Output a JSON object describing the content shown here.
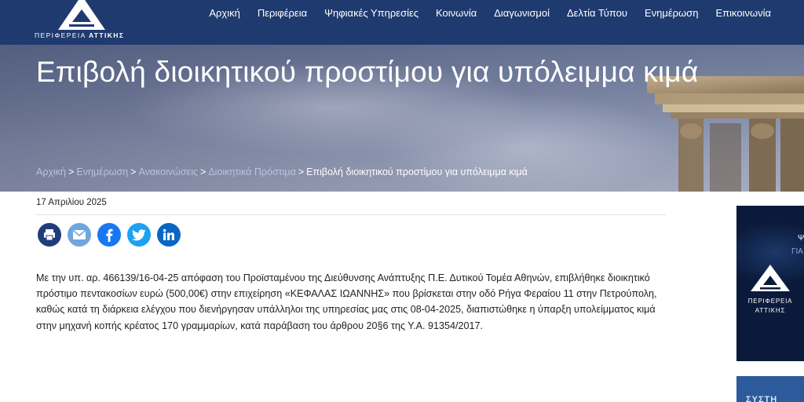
{
  "header": {
    "logo_text_prefix": "ΠΕΡΙΦΕΡΕΙΑ",
    "logo_text_bold": "ΑΤΤΙΚΗΣ",
    "nav": [
      {
        "label": "Αρχική"
      },
      {
        "label": "Περιφέρεια"
      },
      {
        "label": "Ψηφιακές Υπηρεσίες"
      },
      {
        "label": "Κοινωνία"
      },
      {
        "label": "Διαγωνισμοί"
      },
      {
        "label": "Δελτία Τύπου"
      },
      {
        "label": "Ενημέρωση"
      },
      {
        "label": "Επικοινωνία"
      }
    ]
  },
  "hero": {
    "title": "Επιβολή διοικητικού προστίμου για υπόλειμμα κιμά",
    "breadcrumb": {
      "items": [
        "Αρχική",
        "Ενημέρωση",
        "Ανακοινώσεις",
        "Διοικητικά Πρόστιμα"
      ],
      "current": "Επιβολή διοικητικού προστίμου για υπόλειμμα κιμά",
      "separator": ">"
    }
  },
  "article": {
    "date": "17 Απριλίου 2025",
    "share_icons": [
      "print-icon",
      "email-icon",
      "facebook-icon",
      "twitter-icon",
      "linkedin-icon"
    ],
    "body": "Με την υπ. αρ. 466139/16-04-25 απόφαση του Προϊσταμένου της Διεύθυνσης Ανάπτυξης Π.Ε. Δυτικού Τομέα Αθηνών, επιβλήθηκε διοικητικό πρόστιμο πεντακοσίων ευρώ (500,00€) στην επιχείρηση «ΚΕΦΑΛΑΣ ΙΩΑΝΝΗΣ» που βρίσκεται στην οδό Ρήγα Φεραίου 11 στην Πετρούπολη, καθώς κατά τη διάρκεια ελέγχου  που διενήργησαν υπάλληλοι της υπηρεσίας μας στις 08-04-2025, διαπιστώθηκε η ύπαρξη υπολείμματος κιμά στην μηχανή κοπής κρέατος 170 γραμμαρίων, κατά παράβαση του άρθρου 20§6 της Υ.Α. 91354/2017."
  },
  "sidebar": {
    "banner1_text1": "Ψ",
    "banner1_text2": "ΓΙΑ",
    "banner1_name_line1": "ΠΕΡΙΦΕΡΕΙΑ",
    "banner1_name_line2": "ΑΤΤΙΚΗΣ",
    "banner2_text": "ΣΥΣΤΗ"
  },
  "colors": {
    "header_bg": "#1f3a6e",
    "print": "#1f3d7a",
    "email": "#6fa6dd",
    "facebook": "#1877f2",
    "twitter": "#1da1f2",
    "linkedin": "#0a66c2"
  }
}
